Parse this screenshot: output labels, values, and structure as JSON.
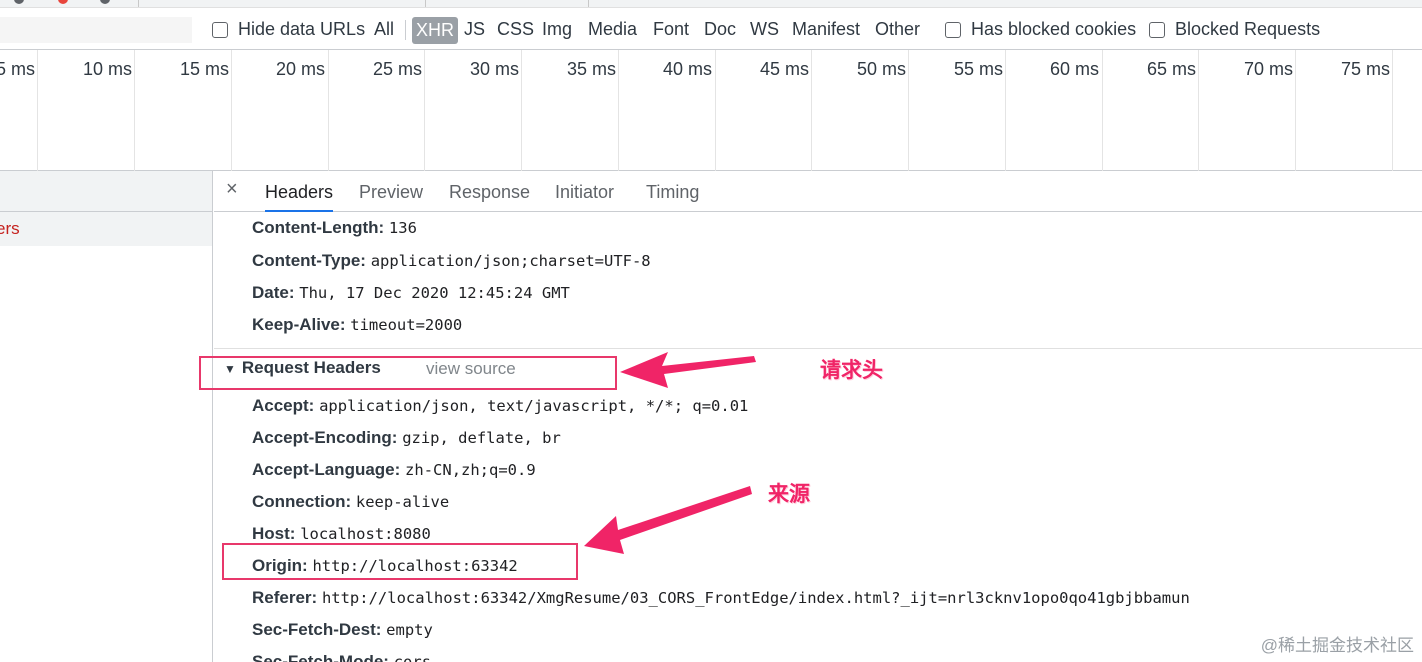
{
  "filter": {
    "input_placeholder": "",
    "hide_data_urls": "Hide data URLs",
    "types": [
      "All",
      "XHR",
      "JS",
      "CSS",
      "Img",
      "Media",
      "Font",
      "Doc",
      "WS",
      "Manifest",
      "Other"
    ],
    "active_type": "XHR",
    "has_blocked_cookies": "Has blocked cookies",
    "blocked_requests": "Blocked Requests"
  },
  "timeline": {
    "ticks": [
      "5 ms",
      "10 ms",
      "15 ms",
      "20 ms",
      "25 ms",
      "30 ms",
      "35 ms",
      "40 ms",
      "45 ms",
      "50 ms",
      "55 ms",
      "60 ms",
      "65 ms",
      "70 ms",
      "75 ms"
    ]
  },
  "left_panel": {
    "selected_item_fragment": "ers"
  },
  "details": {
    "close_glyph": "×",
    "tabs": [
      "Headers",
      "Preview",
      "Response",
      "Initiator",
      "Timing"
    ],
    "active_tab": "Headers",
    "response_headers": [
      {
        "key": "Content-Length:",
        "value": "136"
      },
      {
        "key": "Content-Type:",
        "value": "application/json;charset=UTF-8"
      },
      {
        "key": "Date:",
        "value": "Thu, 17 Dec 2020 12:45:24 GMT"
      },
      {
        "key": "Keep-Alive:",
        "value": "timeout=2000"
      }
    ],
    "request_section": {
      "title": "Request Headers",
      "view_source": "view source"
    },
    "request_headers": [
      {
        "key": "Accept:",
        "value": "application/json, text/javascript, */*; q=0.01"
      },
      {
        "key": "Accept-Encoding:",
        "value": "gzip, deflate, br"
      },
      {
        "key": "Accept-Language:",
        "value": "zh-CN,zh;q=0.9"
      },
      {
        "key": "Connection:",
        "value": "keep-alive"
      },
      {
        "key": "Host:",
        "value": "localhost:8080"
      },
      {
        "key": "Origin:",
        "value": "http://localhost:63342"
      },
      {
        "key": "Referer:",
        "value": "http://localhost:63342/XmgResume/03_CORS_FrontEdge/index.html?_ijt=nrl3cknv1opo0qo41gbjbbamun"
      },
      {
        "key": "Sec-Fetch-Dest:",
        "value": "empty"
      },
      {
        "key": "Sec-Fetch-Mode:",
        "value": "cors"
      }
    ]
  },
  "annotations": {
    "request_headers_label": "请求头",
    "origin_label": "来源",
    "accent_color": "#e8386b"
  },
  "watermark": "@稀土掘金技术社区"
}
